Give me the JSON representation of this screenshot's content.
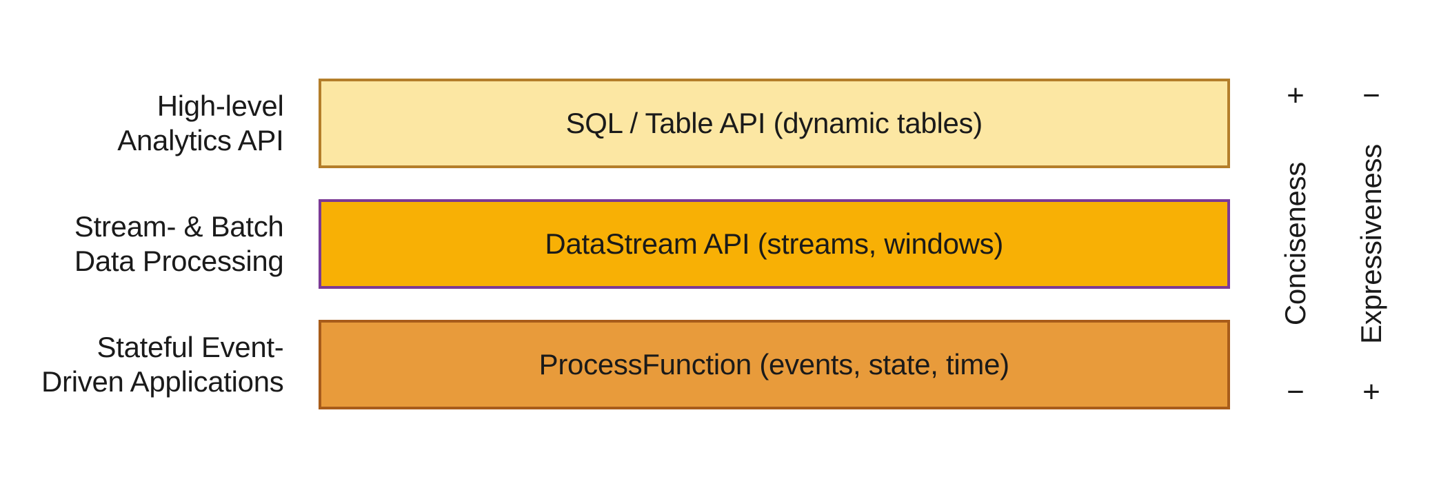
{
  "layers": [
    {
      "label_line1": "High-level",
      "label_line2": "Analytics API",
      "box_text": "SQL / Table API (dynamic tables)",
      "box_class": "box-top"
    },
    {
      "label_line1": "Stream- & Batch",
      "label_line2": "Data Processing",
      "box_text": "DataStream API (streams, windows)",
      "box_class": "box-mid"
    },
    {
      "label_line1": "Stateful Event-",
      "label_line2": "Driven Applications",
      "box_text": "ProcessFunction (events, state, time)",
      "box_class": "box-bot"
    }
  ],
  "annotations": {
    "conciseness": {
      "label": "Conciseness",
      "top_sign": "+",
      "bottom_sign": "−"
    },
    "expressiveness": {
      "label": "Expressiveness",
      "top_sign": "−",
      "bottom_sign": "+"
    }
  }
}
